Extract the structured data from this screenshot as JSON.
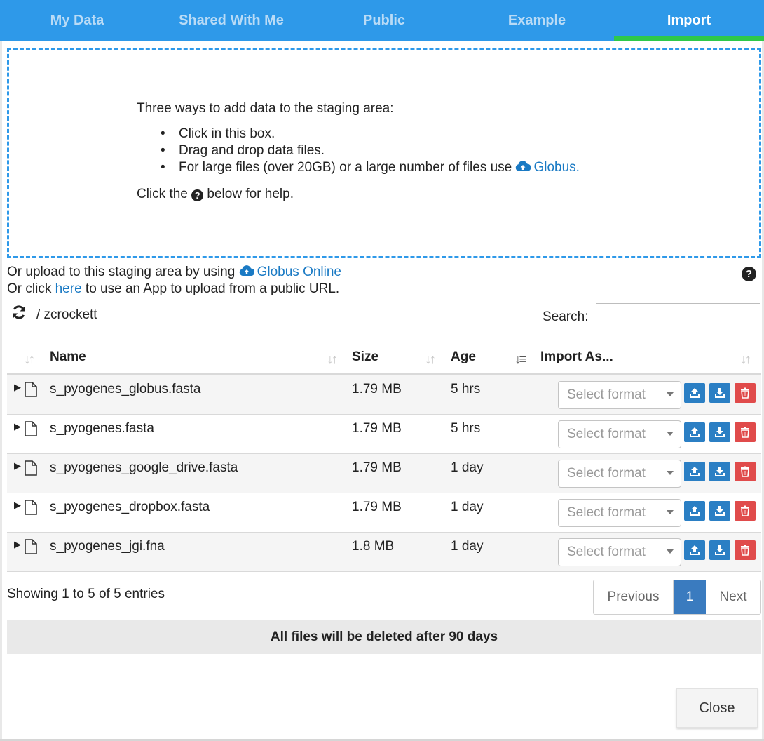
{
  "tabs": [
    {
      "label": "My Data"
    },
    {
      "label": "Shared With Me"
    },
    {
      "label": "Public"
    },
    {
      "label": "Example"
    },
    {
      "label": "Import",
      "active": true
    }
  ],
  "dropzone": {
    "intro": "Three ways to add data to the staging area:",
    "bullets": [
      "Click in this box.",
      "Drag and drop data files.",
      "For large files (over 20GB) or a large number of files use "
    ],
    "globus_link": "Globus.",
    "help_before": "Click the ",
    "help_after": " below for help."
  },
  "upload": {
    "line1_prefix": "Or upload to this staging area by using ",
    "globus_online": "Globus Online",
    "line2_prefix": "Or click ",
    "here": "here",
    "line2_suffix": " to use an App to upload from a public URL."
  },
  "path": "/ zcrockett",
  "search": {
    "label": "Search:",
    "value": ""
  },
  "table": {
    "headers": {
      "name": "Name",
      "size": "Size",
      "age": "Age",
      "import_as": "Import As..."
    },
    "select_placeholder": "Select format",
    "rows": [
      {
        "name": "s_pyogenes_globus.fasta",
        "size": "1.79 MB",
        "age": "5 hrs"
      },
      {
        "name": "s_pyogenes.fasta",
        "size": "1.79 MB",
        "age": "5 hrs"
      },
      {
        "name": "s_pyogenes_google_drive.fasta",
        "size": "1.79 MB",
        "age": "1 day"
      },
      {
        "name": "s_pyogenes_dropbox.fasta",
        "size": "1.79 MB",
        "age": "1 day"
      },
      {
        "name": "s_pyogenes_jgi.fna",
        "size": "1.8 MB",
        "age": "1 day"
      }
    ]
  },
  "info": "Showing 1 to 5 of 5 entries",
  "pagination": {
    "previous": "Previous",
    "page": "1",
    "next": "Next"
  },
  "banner": "All files will be deleted after 90 days",
  "close_label": "Close",
  "colors": {
    "tab_bg": "#2e99e9",
    "tab_active_underline": "#2ec94a",
    "link": "#1a7ac4",
    "action_blue": "#2b7fc4",
    "delete_red": "#e04b4b"
  }
}
